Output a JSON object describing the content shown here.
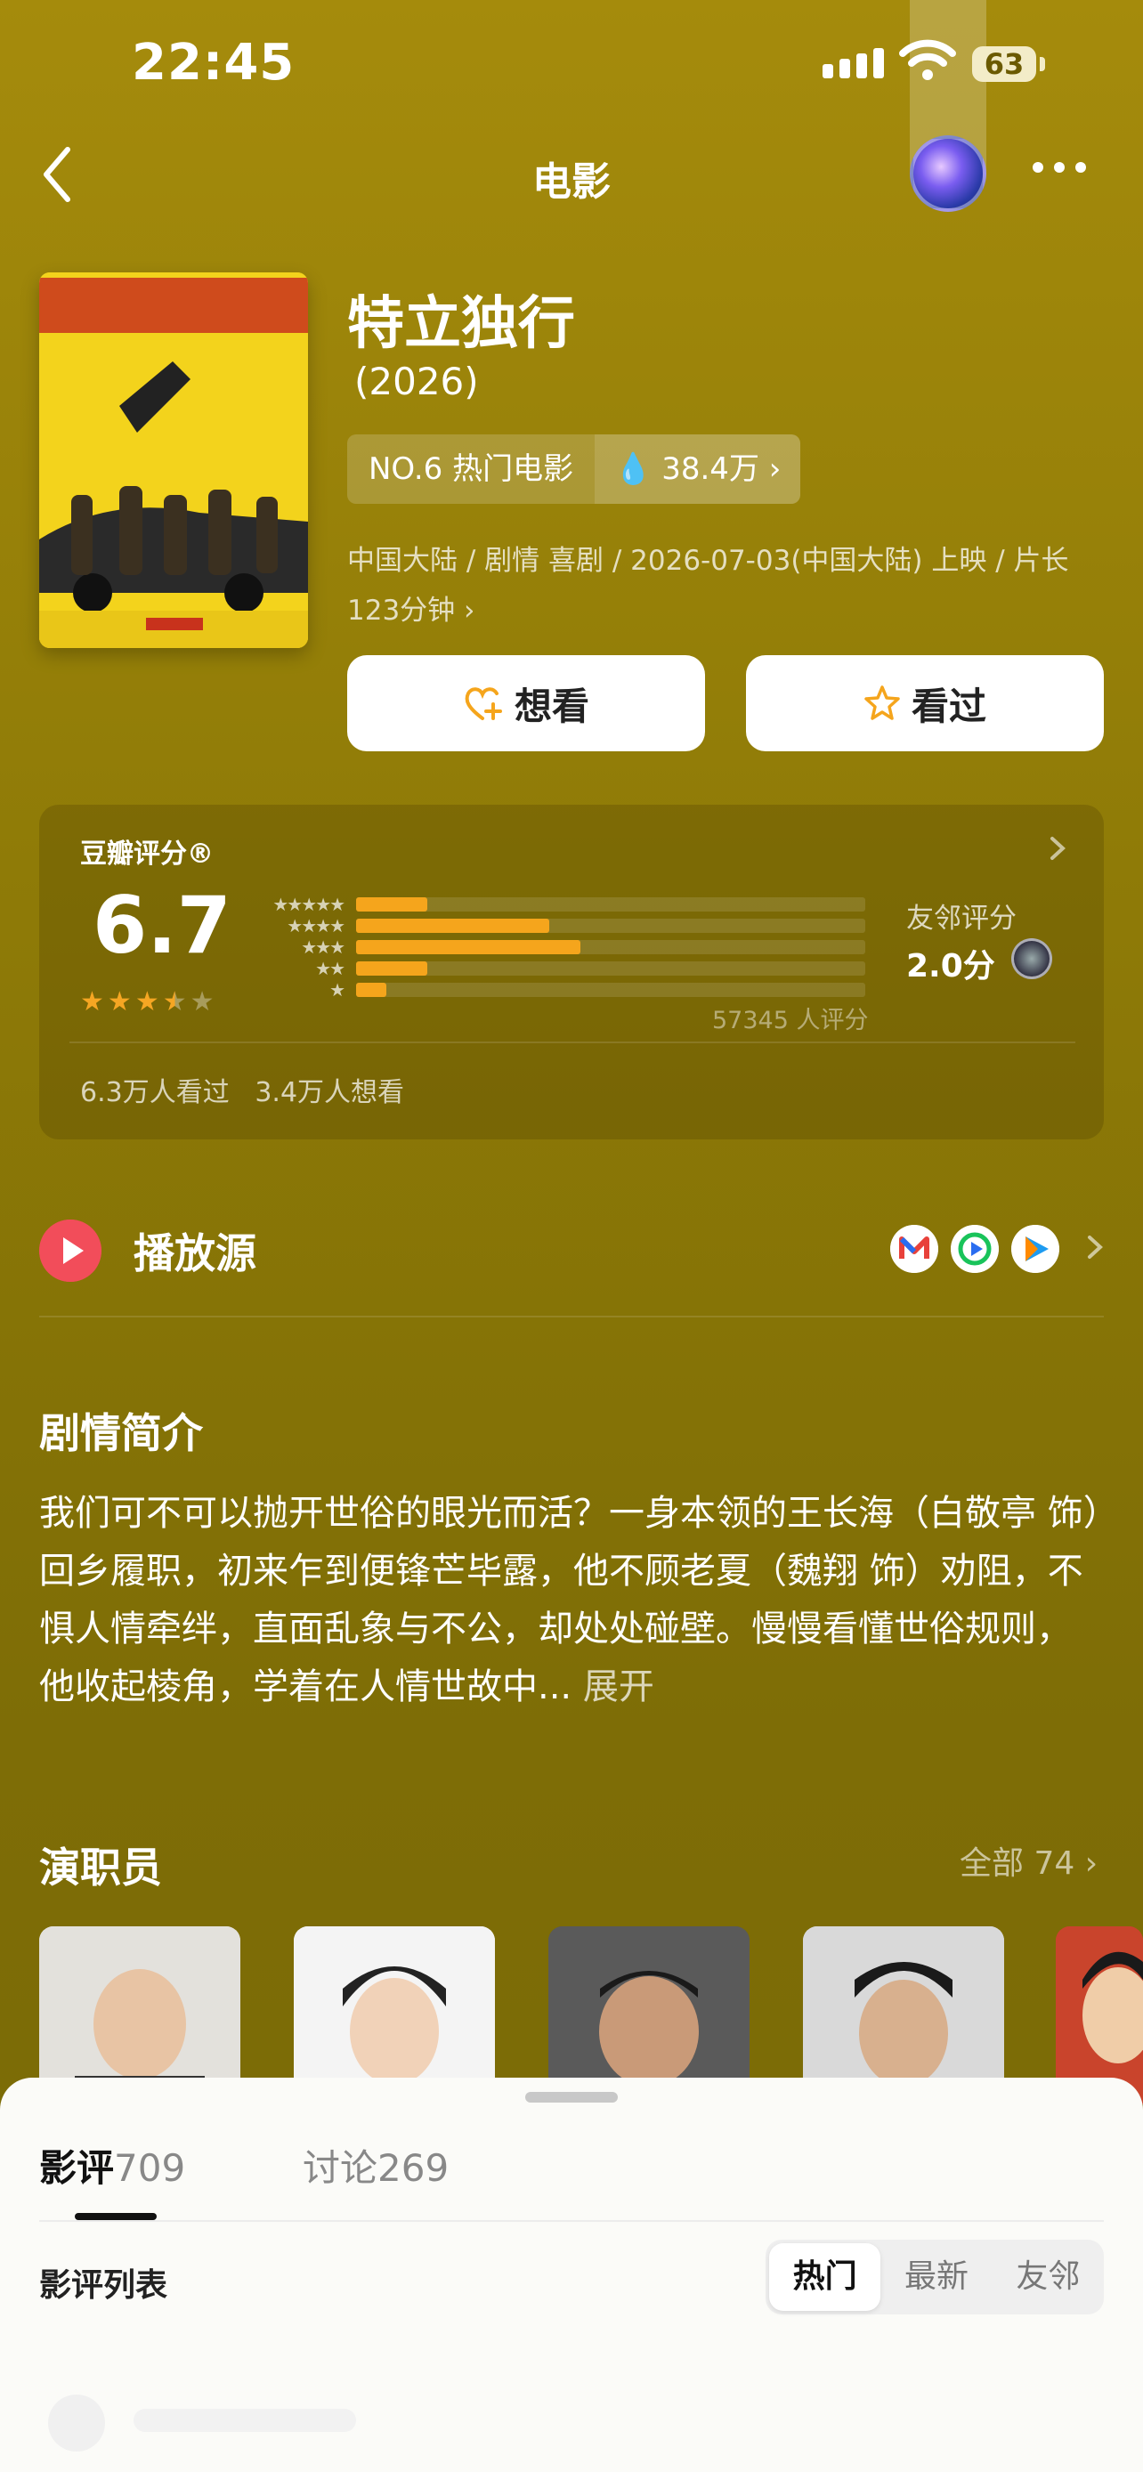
{
  "status": {
    "time": "22:45",
    "battery": "63"
  },
  "nav": {
    "title": "电影"
  },
  "movie": {
    "title": "特立独行",
    "year": "(2026)",
    "rank_label": "NO.6 热门电影",
    "heat": "38.4万",
    "meta_line1": "中国大陆 / 剧情 喜剧 / 2026-07-03(中国大陆) 上映 / 片长",
    "meta_line2": "123分钟"
  },
  "actions": {
    "want": "想看",
    "watched": "看过"
  },
  "rating": {
    "label": "豆瓣评分®",
    "score": "6.7",
    "stars": 3.5,
    "distribution": [
      0.07,
      0.19,
      0.22,
      0.07,
      0.03
    ],
    "count": "57345 人评分",
    "friends_label": "友邻评分",
    "friends_score": "2.0分",
    "seen": "6.3万人看过",
    "want": "3.4万人想看"
  },
  "play": {
    "label": "播放源",
    "sources": [
      "mango-tv-icon",
      "iqiyi-icon",
      "tencent-video-icon"
    ]
  },
  "synopsis": {
    "heading": "剧情简介",
    "text": "我们可不可以抛开世俗的眼光而活？一身本领的王长海（白敬亭 饰）回乡履职，初来乍到便锋芒毕露，他不顾老夏（魏翔 饰）劝阻，不惧人情牵绊，直面乱象与不公，却处处碰壁。慢慢看懂世俗规则，他收起棱角，学着在人情世故中...",
    "expand": "展开"
  },
  "cast": {
    "heading": "演职员",
    "all": "全部 74"
  },
  "sheet": {
    "tab_reviews": "影评",
    "reviews_count": "709",
    "tab_discuss": "讨论",
    "discuss_count": "269",
    "list_label": "影评列表",
    "sort": [
      "热门",
      "最新",
      "友邻"
    ]
  },
  "colors": {
    "accent": "#f5a51c",
    "bg": "#8f7b07",
    "play": "#f24d5a"
  }
}
